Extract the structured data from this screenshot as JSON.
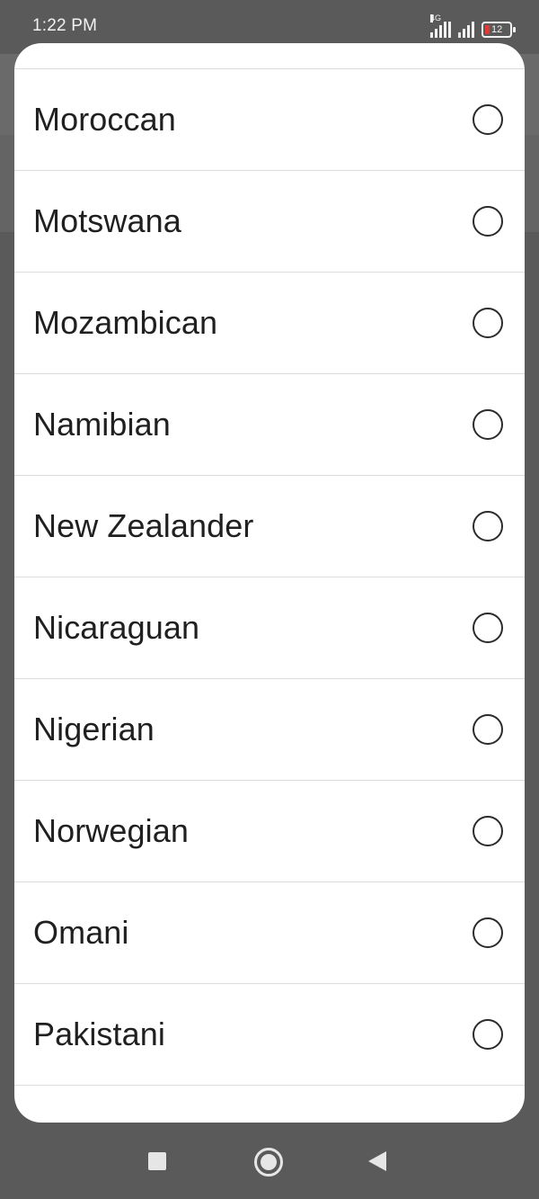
{
  "status_bar": {
    "time": "1:22 PM",
    "network_type": "4G",
    "battery_level": "12",
    "icons": [
      "signal-icon",
      "signal-icon",
      "battery-icon"
    ]
  },
  "nationality_list": {
    "items": [
      {
        "label": "Moroccan",
        "selected": false
      },
      {
        "label": "Motswana",
        "selected": false
      },
      {
        "label": "Mozambican",
        "selected": false
      },
      {
        "label": "Namibian",
        "selected": false
      },
      {
        "label": "New Zealander",
        "selected": false
      },
      {
        "label": "Nicaraguan",
        "selected": false
      },
      {
        "label": "Nigerian",
        "selected": false
      },
      {
        "label": "Norwegian",
        "selected": false
      },
      {
        "label": "Omani",
        "selected": false
      },
      {
        "label": "Pakistani",
        "selected": false
      }
    ]
  },
  "nav_bar": {
    "icons": [
      "recents-icon",
      "home-icon",
      "back-icon"
    ]
  },
  "colors": {
    "scrim": "#5a5a5a",
    "sheet": "#ffffff",
    "text": "#202020",
    "divider": "#dcdcdc",
    "battery_low": "#e53935"
  }
}
